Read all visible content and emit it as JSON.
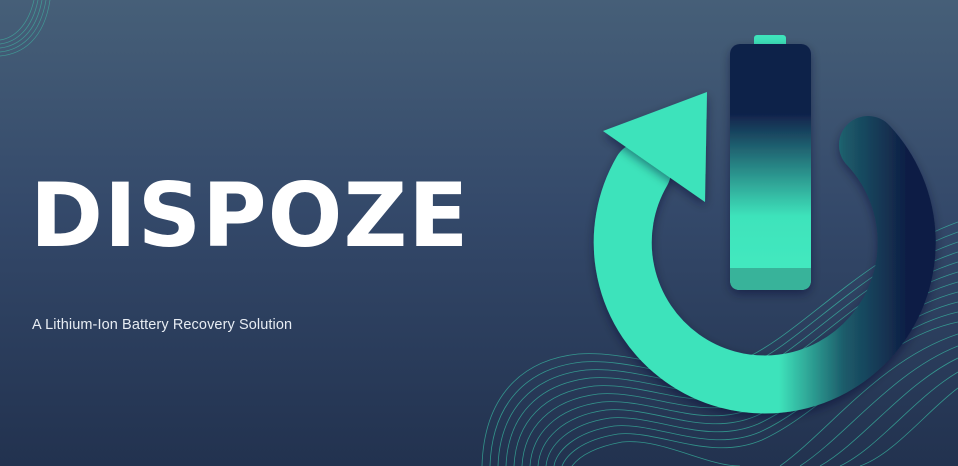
{
  "slide": {
    "title": "DISPOZE",
    "subtitle": "A Lithium-Ion Battery Recovery Solution"
  },
  "colors": {
    "background_top": "#465f78",
    "background_bottom": "#22324f",
    "accent_teal": "#3ee3bb",
    "dark_navy": "#0f1e45",
    "title_text": "#ffffff"
  },
  "graphics": {
    "logo": "recycle-power-battery-icon",
    "decoration": "teal-contour-lines"
  }
}
